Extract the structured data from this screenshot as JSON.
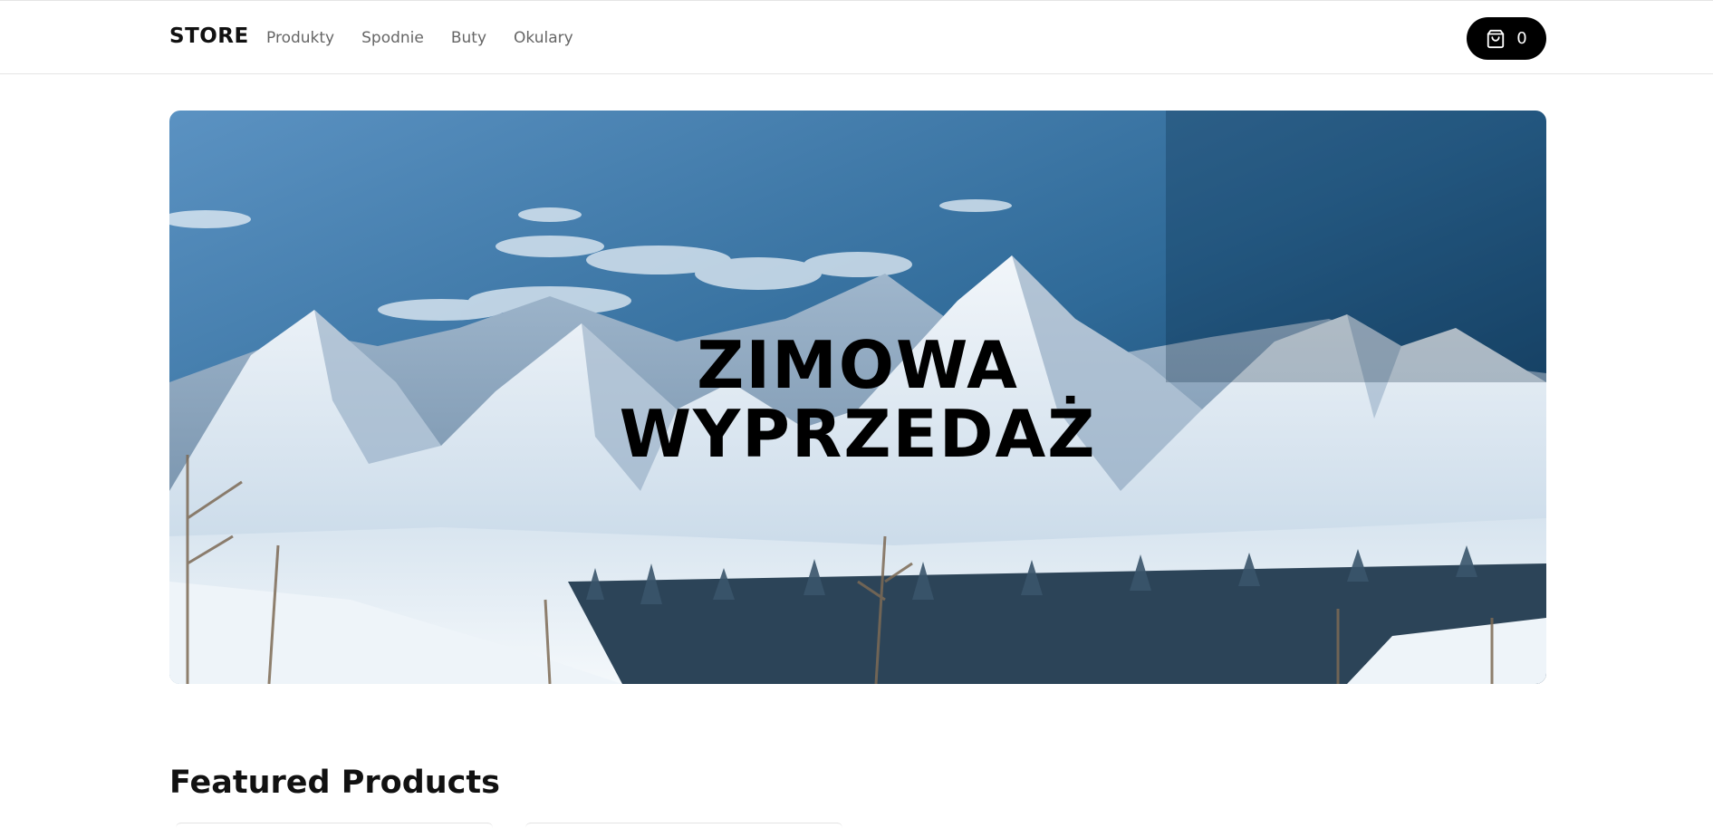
{
  "header": {
    "brand": "STORE",
    "nav": [
      {
        "label": "Produkty"
      },
      {
        "label": "Spodnie"
      },
      {
        "label": "Buty"
      },
      {
        "label": "Okulary"
      }
    ],
    "cart": {
      "count": "0",
      "icon": "shopping-bag-icon"
    }
  },
  "hero": {
    "title_line1": "ZIMOWA",
    "title_line2": "WYPRZEDAŻ",
    "image": "snowy-mountains-photo"
  },
  "featured": {
    "title": "Featured Products"
  },
  "colors": {
    "accent": "#000000",
    "nav_text": "#666666",
    "sky_top": "#0d3a5c",
    "sky_bottom": "#6aa6cf"
  }
}
